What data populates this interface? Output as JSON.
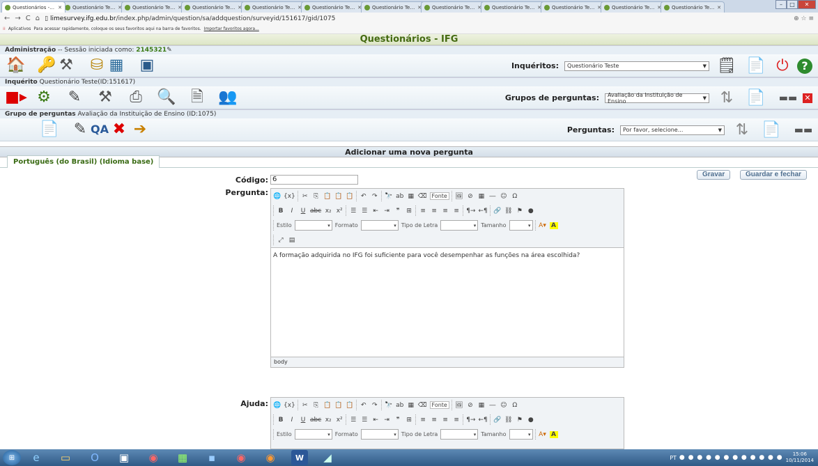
{
  "browser": {
    "tabs": [
      {
        "title": "Questionários - IFG",
        "active": true
      },
      {
        "title": "Questionário Teste"
      },
      {
        "title": "Questionário Teste"
      },
      {
        "title": "Questionário Teste"
      },
      {
        "title": "Questionário Teste"
      },
      {
        "title": "Questionário Teste"
      },
      {
        "title": "Questionário Teste"
      },
      {
        "title": "Questionário Teste"
      },
      {
        "title": "Questionário Teste"
      },
      {
        "title": "Questionário Teste"
      },
      {
        "title": "Questionário Teste"
      },
      {
        "title": "Questionário Teste"
      }
    ],
    "url_domain": "limesurvey.ifg.edu.br",
    "url_path": "/index.php/admin/question/sa/addquestion/surveyid/151617/gid/1075",
    "bookmarks_apps": "Aplicativos",
    "bookmarks_hint": "Para acessar rapidamente, coloque os seus favoritos aqui na barra de favoritos.",
    "bookmarks_import": "Importar favoritos agora..."
  },
  "page_title": "Questionários - IFG",
  "admin": {
    "label": "Administração",
    "session_text": "-- Sessão iniciada como:",
    "user": "2145321",
    "surveys_label": "Inquéritos:",
    "surveys_selected": "Questionário Teste"
  },
  "survey": {
    "label": "Inquérito",
    "name": "Questionário Teste(ID:151617)",
    "groups_label": "Grupos de perguntas:",
    "groups_selected": "Avaliação da Instituição de Ensino"
  },
  "group": {
    "label": "Grupo de perguntas",
    "name": "Avaliação da Instituição de Ensino (ID:1075)",
    "questions_label": "Perguntas:",
    "questions_selected": "Por favor, selecione..."
  },
  "form": {
    "header": "Adicionar uma nova pergunta",
    "language_tab": "Português (do Brasil) (Idioma base)",
    "save_button": "Gravar",
    "save_close_button": "Guardar e fechar",
    "code_label": "Código:",
    "code_value": "6",
    "question_label": "Pergunta:",
    "question_text": "A formação adquirida no IFG foi suficiente para você desempenhar as funções na área escolhida?",
    "path": "body",
    "help_label": "Ajuda:"
  },
  "editor_labels": {
    "source": "Fonte",
    "style": "Estilo",
    "format": "Formato",
    "font": "Tipo de Letra",
    "size": "Tamanho"
  },
  "taskbar": {
    "time": "15:06",
    "date": "10/11/2014",
    "lang": "PT"
  }
}
